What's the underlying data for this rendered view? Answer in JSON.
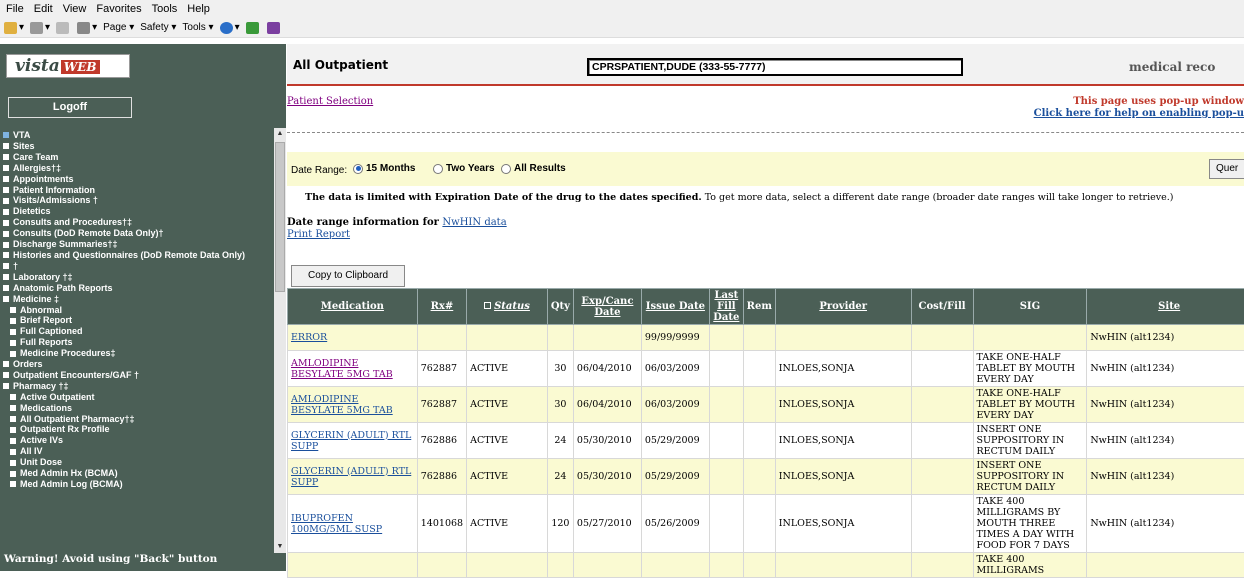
{
  "menu": [
    "File",
    "Edit",
    "View",
    "Favorites",
    "Tools",
    "Help"
  ],
  "toolbar": {
    "page": "Page ▾",
    "safety": "Safety ▾",
    "tools": "Tools ▾"
  },
  "sidebar": {
    "logo_text": "vista",
    "logo_badge": "WEB",
    "logoff": "Logoff",
    "items": [
      {
        "label": "VTA",
        "sub": false
      },
      {
        "label": "Sites",
        "sub": false
      },
      {
        "label": "Care Team",
        "sub": false
      },
      {
        "label": "Allergies†‡",
        "sub": false
      },
      {
        "label": "Appointments",
        "sub": false
      },
      {
        "label": "Patient Information",
        "sub": false
      },
      {
        "label": "Visits/Admissions †",
        "sub": false
      },
      {
        "label": "Dietetics",
        "sub": false
      },
      {
        "label": "Consults and Procedures†‡",
        "sub": false
      },
      {
        "label": "Consults (DoD Remote Data Only)†",
        "sub": false
      },
      {
        "label": "Discharge Summaries†‡",
        "sub": false
      },
      {
        "label": "Histories and Questionnaires (DoD Remote Data Only)",
        "sub": false
      },
      {
        "label": "†",
        "sub": false
      },
      {
        "label": "Laboratory †‡",
        "sub": false
      },
      {
        "label": "Anatomic Path Reports",
        "sub": false
      },
      {
        "label": "Medicine ‡",
        "sub": false
      },
      {
        "label": "Abnormal",
        "sub": true
      },
      {
        "label": "Brief Report",
        "sub": true
      },
      {
        "label": "Full Captioned",
        "sub": true
      },
      {
        "label": "Full Reports",
        "sub": true
      },
      {
        "label": "Medicine Procedures‡",
        "sub": true
      },
      {
        "label": "Orders",
        "sub": false
      },
      {
        "label": "Outpatient Encounters/GAF †",
        "sub": false
      },
      {
        "label": "Pharmacy †‡",
        "sub": false
      },
      {
        "label": "Active Outpatient",
        "sub": true
      },
      {
        "label": "Medications",
        "sub": true
      },
      {
        "label": "All Outpatient Pharmacy†‡",
        "sub": true
      },
      {
        "label": "Outpatient Rx Profile",
        "sub": true
      },
      {
        "label": "Active IVs",
        "sub": true
      },
      {
        "label": "All IV",
        "sub": true
      },
      {
        "label": "Unit Dose",
        "sub": true
      },
      {
        "label": "Med Admin Hx (BCMA)",
        "sub": true
      },
      {
        "label": "Med Admin Log (BCMA)",
        "sub": true
      }
    ],
    "warning": "Warning! Avoid using \"Back\" button"
  },
  "header": {
    "title": "All Outpatient",
    "patient": "CPRSPATIENT,DUDE (333-55-7777)",
    "medical_record": "medical reco"
  },
  "links": {
    "patient_selection": "Patient Selection",
    "popup_notice": "This page uses pop-up window",
    "popup_help": "Click here for help on enabling pop-u",
    "print_report": "Print Report"
  },
  "date_range": {
    "label": "Date Range:",
    "options": [
      "15 Months",
      "Two Years",
      "All Results"
    ],
    "selected": "15 Months",
    "query": "Quer"
  },
  "limit_text": {
    "bold": "The data is limited with Expiration Date of the drug to the dates specified.",
    "rest": " To get more data, select a different date range (broader date ranges will take longer to retrieve.)"
  },
  "date_info": {
    "label": "Date range information for ",
    "link": "NwHIN data"
  },
  "copy_button": "Copy to Clipboard",
  "table": {
    "headers": [
      "Medication",
      "Rx#",
      "Status",
      "Qty",
      "Exp/Canc Date",
      "Issue Date",
      "Last Fill Date",
      "Rem",
      "Provider",
      "Cost/Fill",
      "SIG",
      "Site"
    ],
    "rows": [
      {
        "med": "ERROR",
        "rx": "",
        "status": "",
        "qty": "",
        "exp": "",
        "issue": "99/99/9999",
        "last": "",
        "rem": "",
        "provider": "",
        "cost": "",
        "sig": "",
        "site": "NwHIN (alt1234)"
      },
      {
        "med": "AMLODIPINE BESYLATE 5MG TAB",
        "rx": "762887",
        "status": "ACTIVE",
        "qty": "30",
        "exp": "06/04/2010",
        "issue": "06/03/2009",
        "last": "",
        "rem": "",
        "provider": "INLOES,SONJA",
        "cost": "",
        "sig": "TAKE ONE-HALF TABLET BY MOUTH EVERY DAY",
        "site": "NwHIN (alt1234)"
      },
      {
        "med": "AMLODIPINE BESYLATE 5MG TAB",
        "rx": "762887",
        "status": "ACTIVE",
        "qty": "30",
        "exp": "06/04/2010",
        "issue": "06/03/2009",
        "last": "",
        "rem": "",
        "provider": "INLOES,SONJA",
        "cost": "",
        "sig": "TAKE ONE-HALF TABLET BY MOUTH EVERY DAY",
        "site": "NwHIN (alt1234)"
      },
      {
        "med": "GLYCERIN (ADULT) RTL SUPP",
        "rx": "762886",
        "status": "ACTIVE",
        "qty": "24",
        "exp": "05/30/2010",
        "issue": "05/29/2009",
        "last": "",
        "rem": "",
        "provider": "INLOES,SONJA",
        "cost": "",
        "sig": "INSERT ONE SUPPOSITORY IN RECTUM DAILY",
        "site": "NwHIN (alt1234)"
      },
      {
        "med": "GLYCERIN (ADULT) RTL SUPP",
        "rx": "762886",
        "status": "ACTIVE",
        "qty": "24",
        "exp": "05/30/2010",
        "issue": "05/29/2009",
        "last": "",
        "rem": "",
        "provider": "INLOES,SONJA",
        "cost": "",
        "sig": "INSERT ONE SUPPOSITORY IN RECTUM DAILY",
        "site": "NwHIN (alt1234)"
      },
      {
        "med": "IBUPROFEN 100MG/5ML SUSP",
        "rx": "1401068",
        "status": "ACTIVE",
        "qty": "120",
        "exp": "05/27/2010",
        "issue": "05/26/2009",
        "last": "",
        "rem": "",
        "provider": "INLOES,SONJA",
        "cost": "",
        "sig": "TAKE 400 MILLIGRAMS BY MOUTH THREE TIMES A DAY WITH FOOD FOR 7 DAYS",
        "site": "NwHIN (alt1234)"
      },
      {
        "med": "",
        "rx": "",
        "status": "",
        "qty": "",
        "exp": "",
        "issue": "",
        "last": "",
        "rem": "",
        "provider": "",
        "cost": "",
        "sig": "TAKE 400 MILLIGRAMS",
        "site": ""
      }
    ]
  }
}
